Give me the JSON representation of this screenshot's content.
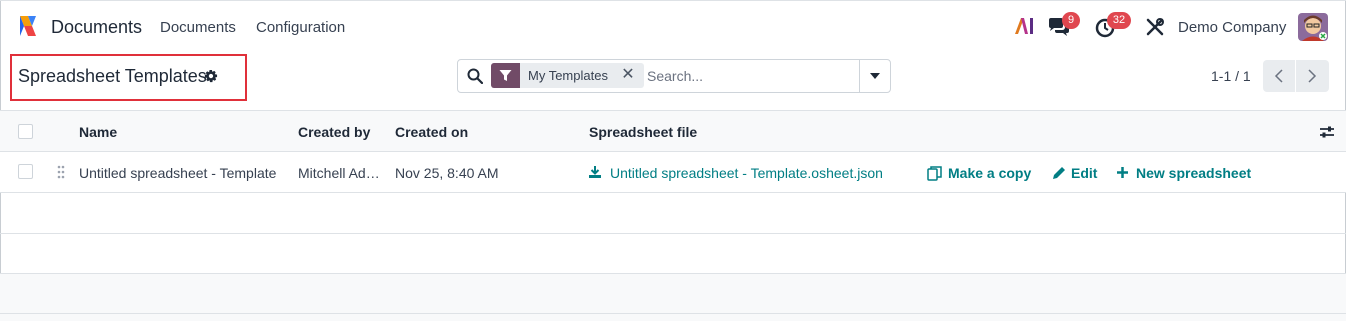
{
  "navbar": {
    "app_name": "Documents",
    "menu": [
      "Documents",
      "Configuration"
    ],
    "chat_badge": "9",
    "activity_badge": "32",
    "company": "Demo Company"
  },
  "control_panel": {
    "title": "Spreadsheet Templates",
    "search": {
      "facet_label": "My Templates",
      "placeholder": "Search..."
    },
    "pager": "1-1 / 1"
  },
  "list": {
    "columns": [
      "Name",
      "Created by",
      "Created on",
      "Spreadsheet file"
    ],
    "rows": [
      {
        "name": "Untitled spreadsheet - Template",
        "created_by": "Mitchell Admin",
        "created_on": "Nov 25, 8:40 AM",
        "file": "Untitled spreadsheet - Template.osheet.json",
        "actions": [
          "Make a copy",
          "Edit",
          "New spreadsheet"
        ]
      }
    ]
  },
  "colors": {
    "brand": "#714b67",
    "link": "#017e84",
    "badge": "#e0474f",
    "highlight_border": "#e0303a"
  },
  "icons": [
    "app-logo",
    "ai-icon",
    "chat-icon",
    "activity-clock-icon",
    "debug-tools-icon",
    "avatar",
    "gear-icon",
    "search-icon",
    "filter-icon",
    "close-icon",
    "caret-down-icon",
    "chevron-left-icon",
    "chevron-right-icon",
    "column-settings-icon",
    "drag-handle-icon",
    "download-icon",
    "copy-icon",
    "pencil-icon",
    "plus-icon"
  ]
}
